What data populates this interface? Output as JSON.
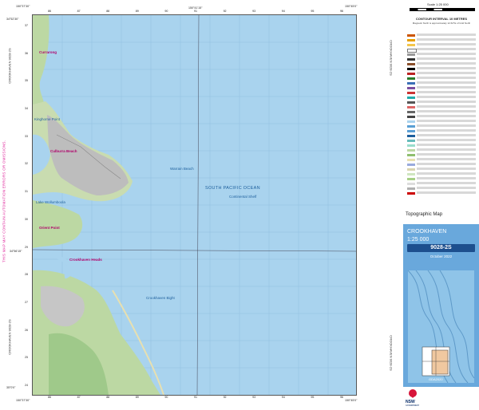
{
  "margin": {
    "left_vertical_text": "CROOKHAVEN 9028-2S",
    "left_vertical_text_2": "CROOKHAVEN 9028-2S",
    "right_vertical_text": "CROOKHAVEN 9028-2S",
    "right_vertical_text_2": "CROOKHAVEN 9028-2S",
    "disclaimer": "THIS MAP MAY CONTAIN AUTOMATION ERRORS OR OMISSIONS.",
    "corner_tl": "150°37'30\"",
    "corner_tr": "150°45'0\"",
    "corner_bl": "150°37'30\"",
    "corner_br": "150°45'0\"",
    "lat_top": "34°52'30\"",
    "lat_bottom": "35°0'0\"",
    "lat_mid": "34°56'15\"",
    "lon_mid": "150°41'15\"",
    "top_ticks": [
      "86",
      "87",
      "88",
      "89",
      "90",
      "91",
      "92",
      "93",
      "94",
      "95",
      "96"
    ],
    "left_ticks": [
      "37",
      "36",
      "35",
      "34",
      "33",
      "32",
      "31",
      "30",
      "29",
      "28",
      "27",
      "26",
      "25",
      "24"
    ]
  },
  "map": {
    "ocean_label": "SOUTH PACIFIC OCEAN",
    "ocean_sublabel": "Continental Shelf",
    "labels": [
      {
        "text": "Currarong",
        "kind": "town"
      },
      {
        "text": "Crookhaven Heads",
        "kind": "town"
      },
      {
        "text": "Culburra Beach",
        "kind": "town"
      },
      {
        "text": "Orient Point",
        "kind": "town"
      },
      {
        "text": "Warrain Beach",
        "kind": "water"
      },
      {
        "text": "Crookhaven Bight",
        "kind": "water"
      },
      {
        "text": "Lake Wollumboola",
        "kind": "water"
      },
      {
        "text": "Kinghorne Point",
        "kind": "water"
      }
    ]
  },
  "panel": {
    "scale_title": "Scale 1:25 000",
    "contour_interval": "CONTOUR INTERVAL 10 METRES",
    "contour_sub": "Magnetic North is approximately 12.62°E of Grid North",
    "map_type": "Topographic Map",
    "map_name": "CROOKHAVEN",
    "map_scale": "1:25 000",
    "sheet_no": "9028-2S",
    "edition": "October 2022",
    "gda": "GDA2020",
    "nsw": "NSW",
    "nsw_sub": "GOVERNMENT"
  },
  "colors": {
    "ocean": "#a9d3ee",
    "land": "#e7e4d6",
    "vegetation": "#bcd8a3",
    "urban": "#bbbbbb",
    "title_blue": "#69a8dc",
    "disclaimer": "#e02a9e"
  }
}
